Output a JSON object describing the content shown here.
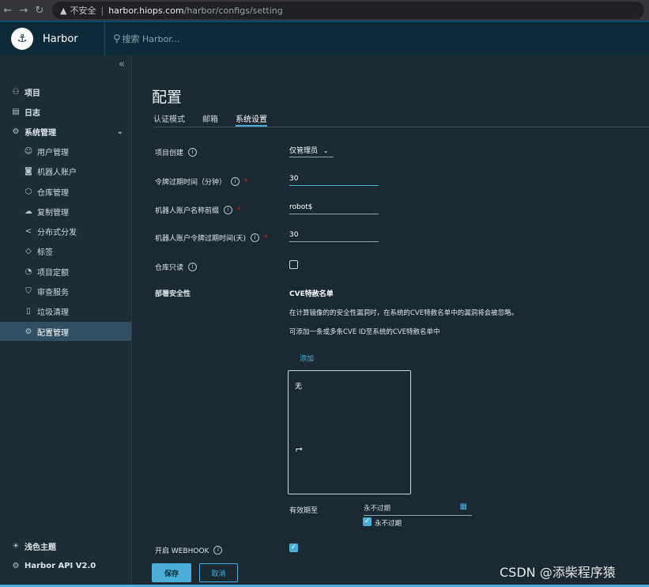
{
  "browser": {
    "insecure_label": "不安全",
    "url_host": "harbor.hiops.com",
    "url_path": "/harbor/configs/setting"
  },
  "header": {
    "brand": "Harbor",
    "search_placeholder": "搜索 Harbor..."
  },
  "sidebar": {
    "items": [
      {
        "label": "项目",
        "icon": "projects-icon"
      },
      {
        "label": "日志",
        "icon": "logs-icon"
      },
      {
        "label": "系统管理",
        "icon": "admin-icon"
      },
      {
        "label": "用户管理",
        "icon": "users-icon"
      },
      {
        "label": "机器人账户",
        "icon": "robot-icon"
      },
      {
        "label": "仓库管理",
        "icon": "registry-icon"
      },
      {
        "label": "复制管理",
        "icon": "replication-icon"
      },
      {
        "label": "分布式分发",
        "icon": "distribution-icon"
      },
      {
        "label": "标签",
        "icon": "tag-icon"
      },
      {
        "label": "项目定额",
        "icon": "quota-icon"
      },
      {
        "label": "审查服务",
        "icon": "shield-icon"
      },
      {
        "label": "垃圾清理",
        "icon": "trash-icon"
      },
      {
        "label": "配置管理",
        "icon": "gear-icon"
      }
    ],
    "footer": [
      {
        "label": "浅色主题",
        "icon": "sun-icon"
      },
      {
        "label": "Harbor API V2.0",
        "icon": "api-icon"
      }
    ]
  },
  "main": {
    "title": "配置",
    "tabs": [
      "认证模式",
      "邮箱",
      "系统设置"
    ],
    "active_tab": "系统设置",
    "fields": {
      "project_creation": {
        "label": "项目创建",
        "value": "仅管理员"
      },
      "token_expiration": {
        "label": "令牌过期时间（分钟）",
        "value": "30"
      },
      "robot_prefix": {
        "label": "机器人账户名称前缀",
        "value": "robot$"
      },
      "robot_token_expiration": {
        "label": "机器人账户令牌过期时间(天)",
        "value": "30"
      },
      "repo_readonly": {
        "label": "仓库只读",
        "checked": false
      },
      "deployment_security": {
        "label": "部署安全性"
      }
    },
    "cve": {
      "title": "CVE特赦名单",
      "desc1": "在计算镜像的的安全性漏洞时，在系统的CVE特赦名单中的漏洞将会被忽略。",
      "desc2": "可添加一条或多条CVE ID至系统的CVE特赦名单中",
      "add_label": "添加",
      "empty_text": "无",
      "expire_label": "有效期至",
      "expire_value": "永不过期",
      "never_expire_label": "永不过期",
      "never_expire_checked": true
    },
    "webhook": {
      "label": "开启 WEBHOOK",
      "checked": true
    },
    "buttons": {
      "save": "保存",
      "cancel": "取消"
    }
  },
  "watermark": "CSDN @添柴程序猿",
  "colors": {
    "accent": "#49afd9",
    "header_bg": "#0e2a38",
    "sidebar_bg": "#1d2d36",
    "main_bg": "#1b2a32",
    "required": "#e12200"
  }
}
